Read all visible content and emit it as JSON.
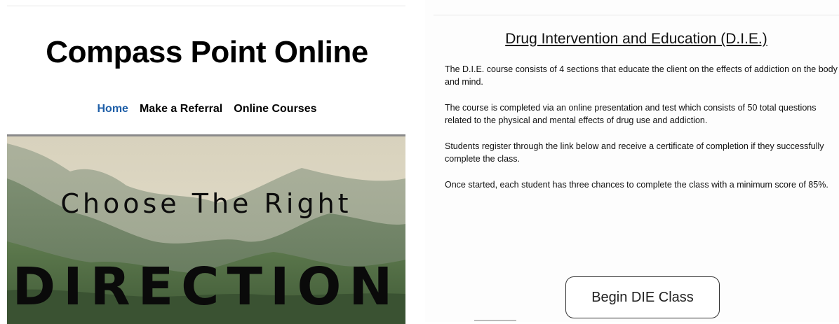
{
  "site": {
    "title": "Compass Point Online",
    "nav": [
      {
        "label": "Home",
        "active": true
      },
      {
        "label": "Make a Referral",
        "active": false
      },
      {
        "label": "Online Courses",
        "active": false
      }
    ],
    "hero": {
      "line1": "Choose The Right",
      "line2": "DIRECTION"
    }
  },
  "course": {
    "title": "Drug Intervention and Education (D.I.E.)",
    "paragraphs": [
      "The D.I.E. course consists of 4 sections that educate the client on the effects of addiction on the body and mind.",
      "The course is completed via an online presentation and test which consists of 50 total questions related to the physical and mental effects of drug use and addiction.",
      "Students register through the link below and receive a certificate of completion if they successfully complete the class.",
      "Once started, each student has three chances to complete the class with a minimum score of 85%."
    ],
    "button_label": "Begin DIE Class"
  },
  "colors": {
    "nav_active": "#1f5fa8",
    "text": "#111111"
  }
}
